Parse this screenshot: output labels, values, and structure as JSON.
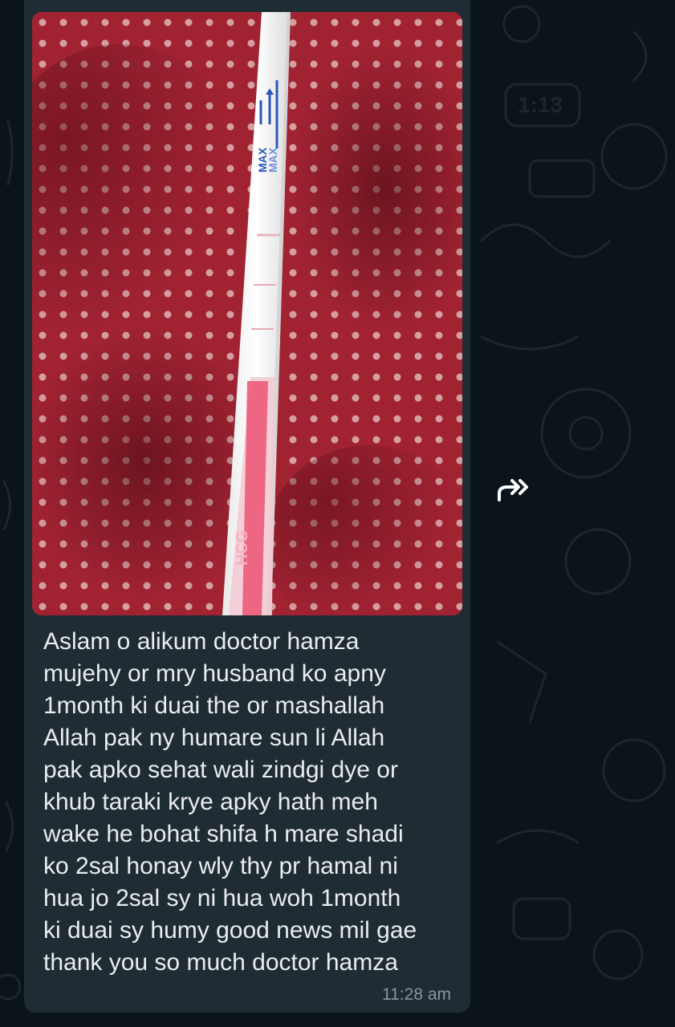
{
  "message": {
    "caption": "Aslam o alikum doctor hamza\nmujehy or mry husband ko apny\n1month ki duai the or mashallah\nAllah pak ny humare sun li Allah\npak apko sehat wali zindgi dye or\nkhub taraki krye apky hath meh\nwake he bohat shifa h mare shadi\nko 2sal honay wly thy pr hamal ni\nhua jo 2sal sy ni hua woh 1month\nki duai sy humy good news mil gae\nthank you so much doctor hamza",
    "time": "11:28 am",
    "photo": {
      "strip_label_top": "MAX",
      "strip_label_top2": "MAX",
      "strip_label_bottom": "HCG"
    }
  },
  "forward": {
    "icon": "forward-icon"
  },
  "colors": {
    "chat_background": "#0b141a",
    "bubble": "#202c33",
    "text": "#e9edef",
    "timestamp": "#8696a0"
  }
}
